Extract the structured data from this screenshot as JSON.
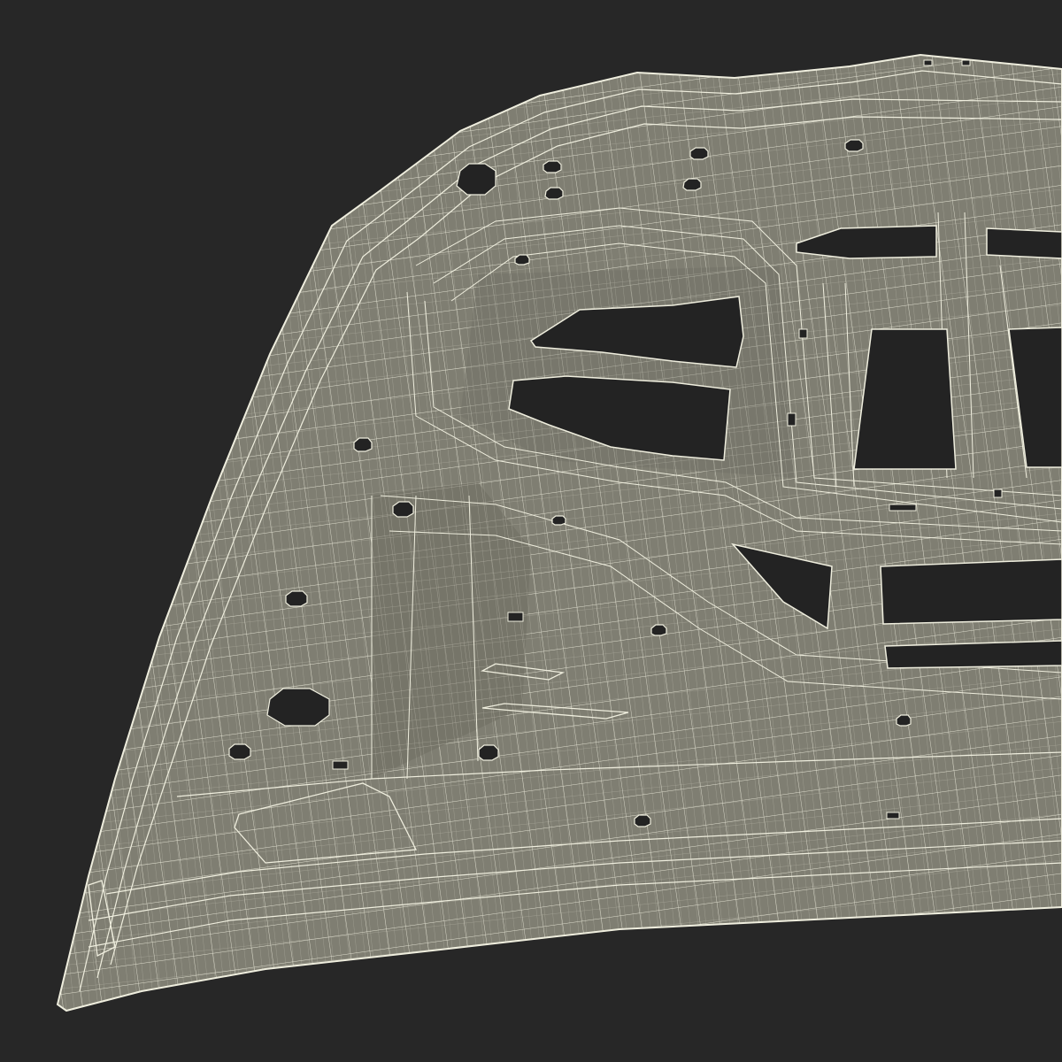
{
  "scene": {
    "subject": "hood-inner-panel-wireframe",
    "colors": {
      "background": "#272727",
      "panel": "#7f7e72",
      "panel_shade": "#6f6e63",
      "wire": "#efeede",
      "hole": "#232323"
    }
  }
}
